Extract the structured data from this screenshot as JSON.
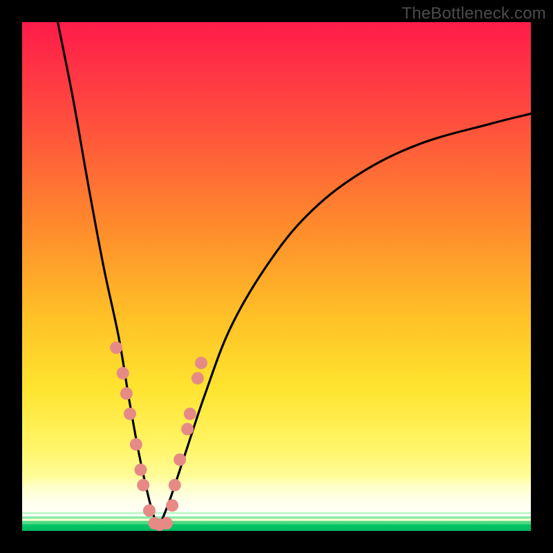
{
  "watermark": "TheBottleneck.com",
  "colors": {
    "frame": "#000000",
    "curve": "#000000",
    "dot_fill": "#e68a86",
    "dot_stroke": "#d9736f",
    "gradient_top": "#ff1b4a",
    "gradient_mid": "#ffc127",
    "gradient_bottom_band": "#00c060"
  },
  "chart_data": {
    "type": "line",
    "title": "",
    "xlabel": "",
    "ylabel": "",
    "xlim": [
      0,
      100
    ],
    "ylim": [
      0,
      100
    ],
    "note": "No axis labels or tick marks are visible; values are estimated relative positions on a 0–100 canvas. Two curves meet near the bottom around x≈26 forming a V. Salmon dots cluster along both curve arms near the bottom.",
    "series": [
      {
        "name": "left-curve",
        "x": [
          7,
          10,
          13,
          16,
          19,
          21,
          23,
          25,
          26.5
        ],
        "y": [
          100,
          85,
          68,
          52,
          38,
          26,
          15,
          6,
          1
        ]
      },
      {
        "name": "right-curve",
        "x": [
          27,
          29,
          32,
          36,
          41,
          48,
          56,
          66,
          78,
          92,
          100
        ],
        "y": [
          1,
          6,
          15,
          27,
          40,
          52,
          62,
          70,
          76,
          80,
          82
        ]
      }
    ],
    "points": [
      {
        "name": "left-dots",
        "coords": [
          {
            "x": 18.5,
            "y": 36
          },
          {
            "x": 19.8,
            "y": 31
          },
          {
            "x": 20.5,
            "y": 27
          },
          {
            "x": 21.2,
            "y": 23
          },
          {
            "x": 22.4,
            "y": 17
          },
          {
            "x": 23.3,
            "y": 12
          },
          {
            "x": 23.8,
            "y": 9
          },
          {
            "x": 25.0,
            "y": 4
          },
          {
            "x": 26.0,
            "y": 1.5
          },
          {
            "x": 27.0,
            "y": 1.2
          },
          {
            "x": 28.4,
            "y": 1.5
          }
        ]
      },
      {
        "name": "right-dots",
        "coords": [
          {
            "x": 29.5,
            "y": 5
          },
          {
            "x": 30.0,
            "y": 9
          },
          {
            "x": 31.0,
            "y": 14
          },
          {
            "x": 32.5,
            "y": 20
          },
          {
            "x": 33.0,
            "y": 23
          },
          {
            "x": 34.5,
            "y": 30
          },
          {
            "x": 35.2,
            "y": 33
          }
        ]
      }
    ]
  }
}
